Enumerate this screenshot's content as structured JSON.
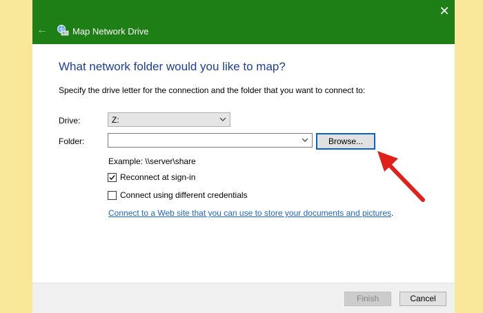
{
  "window": {
    "title": "Map Network Drive",
    "close_glyph": "✕",
    "back_glyph": "←",
    "icons": [
      "map-network-drive-icon",
      "back-arrow-icon",
      "close-icon"
    ]
  },
  "content": {
    "heading": "What network folder would you like to map?",
    "description": "Specify the drive letter for the connection and the folder that you want to connect to:",
    "drive_label": "Drive:",
    "drive_value": "Z:",
    "folder_label": "Folder:",
    "folder_value": "",
    "browse_label": "Browse...",
    "example": "Example: \\\\server\\share",
    "reconnect_label": "Reconnect at sign-in",
    "reconnect_checked": true,
    "credentials_label": "Connect using different credentials",
    "credentials_checked": false,
    "link_text": "Connect to a Web site that you can use to store your documents and pictures",
    "link_suffix": "."
  },
  "footer": {
    "finish_label": "Finish",
    "cancel_label": "Cancel"
  },
  "colors": {
    "titlebar": "#1e7f16",
    "heading": "#1a3e9a",
    "link": "#1a66c9",
    "browse_border": "#0a61c4",
    "annotation_arrow": "#e0201b",
    "background": "#f9e79a"
  }
}
